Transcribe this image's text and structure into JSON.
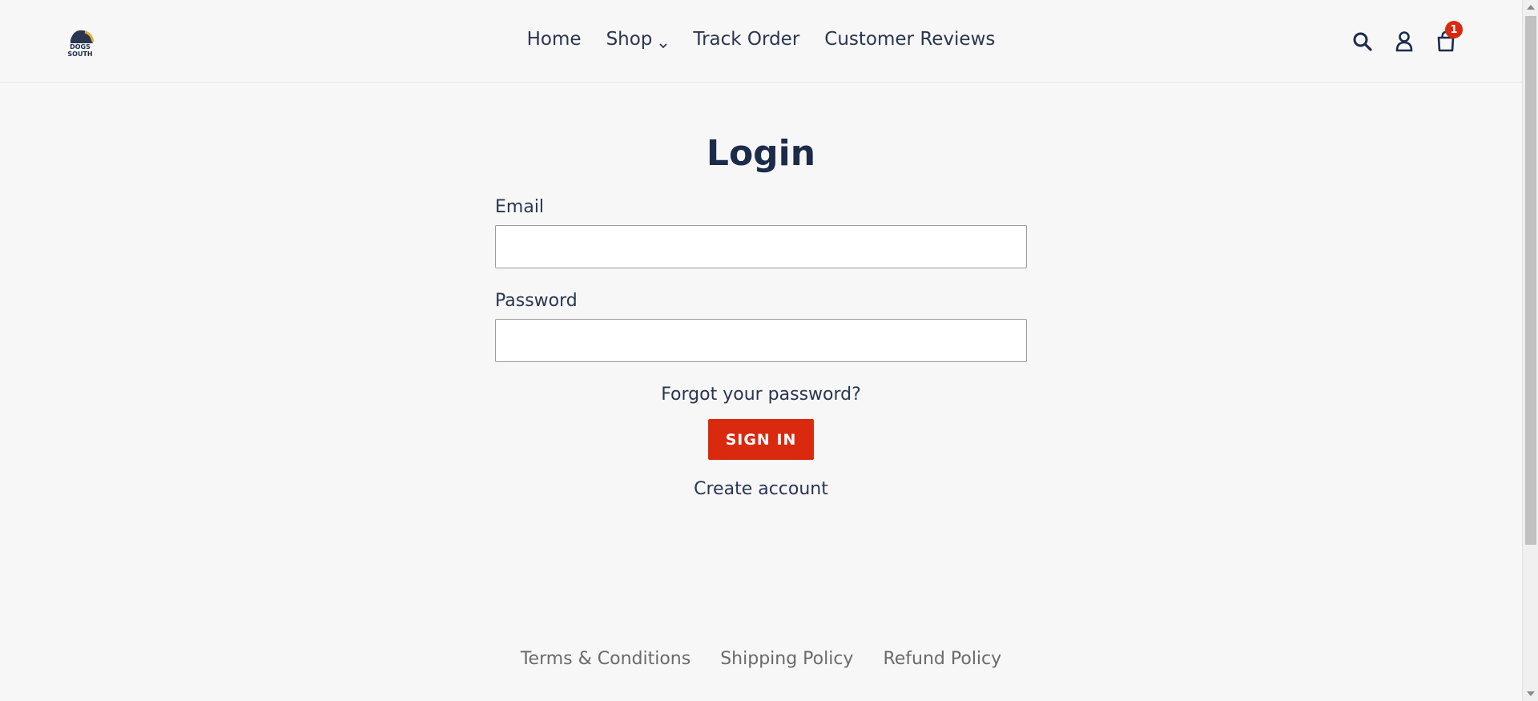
{
  "header": {
    "logo_icon": "bulldog-logo-icon",
    "nav": [
      {
        "label": "Home"
      },
      {
        "label": "Shop",
        "has_dropdown": true
      },
      {
        "label": "Track Order"
      },
      {
        "label": "Customer Reviews"
      }
    ],
    "icons": {
      "search": "search-icon",
      "account": "user-icon",
      "cart": "cart-icon"
    },
    "cart_count": "1"
  },
  "main": {
    "title": "Login",
    "email_label": "Email",
    "email_value": "",
    "password_label": "Password",
    "password_value": "",
    "forgot_label": "Forgot your password?",
    "signin_label": "SIGN IN",
    "create_label": "Create account"
  },
  "footer": {
    "links": [
      {
        "label": "Terms & Conditions"
      },
      {
        "label": "Shipping Policy"
      },
      {
        "label": "Refund Policy"
      }
    ]
  },
  "colors": {
    "accent": "#d9290f",
    "text": "#1c2b4a",
    "background": "#f7f7f7"
  }
}
